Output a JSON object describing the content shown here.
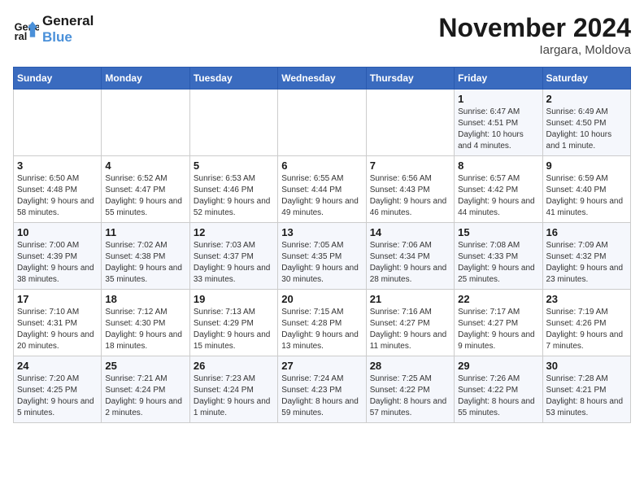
{
  "logo": {
    "line1": "General",
    "line2": "Blue"
  },
  "title": "November 2024",
  "location": "Iargara, Moldova",
  "days_of_week": [
    "Sunday",
    "Monday",
    "Tuesday",
    "Wednesday",
    "Thursday",
    "Friday",
    "Saturday"
  ],
  "weeks": [
    [
      {
        "day": "",
        "info": ""
      },
      {
        "day": "",
        "info": ""
      },
      {
        "day": "",
        "info": ""
      },
      {
        "day": "",
        "info": ""
      },
      {
        "day": "",
        "info": ""
      },
      {
        "day": "1",
        "info": "Sunrise: 6:47 AM\nSunset: 4:51 PM\nDaylight: 10 hours and 4 minutes."
      },
      {
        "day": "2",
        "info": "Sunrise: 6:49 AM\nSunset: 4:50 PM\nDaylight: 10 hours and 1 minute."
      }
    ],
    [
      {
        "day": "3",
        "info": "Sunrise: 6:50 AM\nSunset: 4:48 PM\nDaylight: 9 hours and 58 minutes."
      },
      {
        "day": "4",
        "info": "Sunrise: 6:52 AM\nSunset: 4:47 PM\nDaylight: 9 hours and 55 minutes."
      },
      {
        "day": "5",
        "info": "Sunrise: 6:53 AM\nSunset: 4:46 PM\nDaylight: 9 hours and 52 minutes."
      },
      {
        "day": "6",
        "info": "Sunrise: 6:55 AM\nSunset: 4:44 PM\nDaylight: 9 hours and 49 minutes."
      },
      {
        "day": "7",
        "info": "Sunrise: 6:56 AM\nSunset: 4:43 PM\nDaylight: 9 hours and 46 minutes."
      },
      {
        "day": "8",
        "info": "Sunrise: 6:57 AM\nSunset: 4:42 PM\nDaylight: 9 hours and 44 minutes."
      },
      {
        "day": "9",
        "info": "Sunrise: 6:59 AM\nSunset: 4:40 PM\nDaylight: 9 hours and 41 minutes."
      }
    ],
    [
      {
        "day": "10",
        "info": "Sunrise: 7:00 AM\nSunset: 4:39 PM\nDaylight: 9 hours and 38 minutes."
      },
      {
        "day": "11",
        "info": "Sunrise: 7:02 AM\nSunset: 4:38 PM\nDaylight: 9 hours and 35 minutes."
      },
      {
        "day": "12",
        "info": "Sunrise: 7:03 AM\nSunset: 4:37 PM\nDaylight: 9 hours and 33 minutes."
      },
      {
        "day": "13",
        "info": "Sunrise: 7:05 AM\nSunset: 4:35 PM\nDaylight: 9 hours and 30 minutes."
      },
      {
        "day": "14",
        "info": "Sunrise: 7:06 AM\nSunset: 4:34 PM\nDaylight: 9 hours and 28 minutes."
      },
      {
        "day": "15",
        "info": "Sunrise: 7:08 AM\nSunset: 4:33 PM\nDaylight: 9 hours and 25 minutes."
      },
      {
        "day": "16",
        "info": "Sunrise: 7:09 AM\nSunset: 4:32 PM\nDaylight: 9 hours and 23 minutes."
      }
    ],
    [
      {
        "day": "17",
        "info": "Sunrise: 7:10 AM\nSunset: 4:31 PM\nDaylight: 9 hours and 20 minutes."
      },
      {
        "day": "18",
        "info": "Sunrise: 7:12 AM\nSunset: 4:30 PM\nDaylight: 9 hours and 18 minutes."
      },
      {
        "day": "19",
        "info": "Sunrise: 7:13 AM\nSunset: 4:29 PM\nDaylight: 9 hours and 15 minutes."
      },
      {
        "day": "20",
        "info": "Sunrise: 7:15 AM\nSunset: 4:28 PM\nDaylight: 9 hours and 13 minutes."
      },
      {
        "day": "21",
        "info": "Sunrise: 7:16 AM\nSunset: 4:27 PM\nDaylight: 9 hours and 11 minutes."
      },
      {
        "day": "22",
        "info": "Sunrise: 7:17 AM\nSunset: 4:27 PM\nDaylight: 9 hours and 9 minutes."
      },
      {
        "day": "23",
        "info": "Sunrise: 7:19 AM\nSunset: 4:26 PM\nDaylight: 9 hours and 7 minutes."
      }
    ],
    [
      {
        "day": "24",
        "info": "Sunrise: 7:20 AM\nSunset: 4:25 PM\nDaylight: 9 hours and 5 minutes."
      },
      {
        "day": "25",
        "info": "Sunrise: 7:21 AM\nSunset: 4:24 PM\nDaylight: 9 hours and 2 minutes."
      },
      {
        "day": "26",
        "info": "Sunrise: 7:23 AM\nSunset: 4:24 PM\nDaylight: 9 hours and 1 minute."
      },
      {
        "day": "27",
        "info": "Sunrise: 7:24 AM\nSunset: 4:23 PM\nDaylight: 8 hours and 59 minutes."
      },
      {
        "day": "28",
        "info": "Sunrise: 7:25 AM\nSunset: 4:22 PM\nDaylight: 8 hours and 57 minutes."
      },
      {
        "day": "29",
        "info": "Sunrise: 7:26 AM\nSunset: 4:22 PM\nDaylight: 8 hours and 55 minutes."
      },
      {
        "day": "30",
        "info": "Sunrise: 7:28 AM\nSunset: 4:21 PM\nDaylight: 8 hours and 53 minutes."
      }
    ]
  ]
}
